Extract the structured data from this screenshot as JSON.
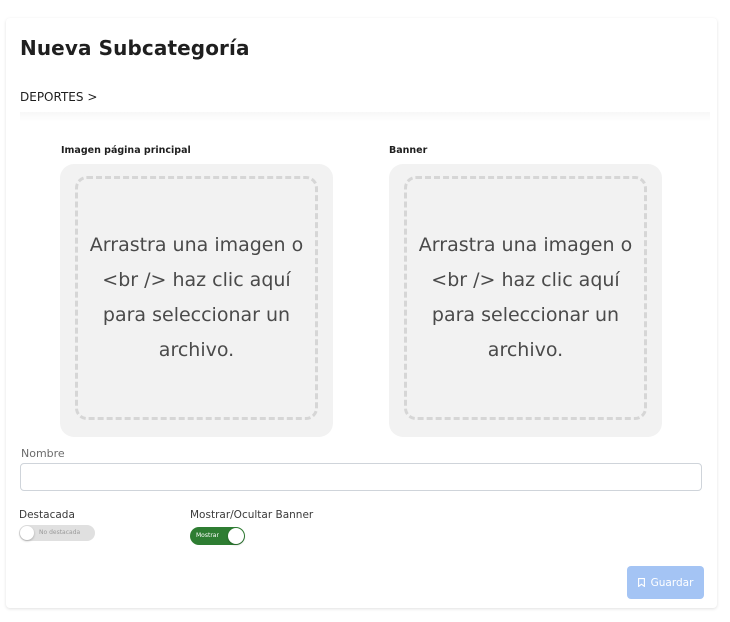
{
  "page": {
    "title": "Nueva Subcategoría",
    "breadcrumb": "DEPORTES >"
  },
  "uploads": {
    "main_image": {
      "label": "Imagen página principal",
      "placeholder": "Arrastra una imagen o <br /> haz clic aquí para seleccionar un archivo."
    },
    "banner": {
      "label": "Banner",
      "placeholder": "Arrastra una imagen o <br /> haz clic aquí para seleccionar un archivo."
    }
  },
  "form": {
    "name_label": "Nombre",
    "name_value": "",
    "featured": {
      "label": "Destacada",
      "state_text": "No destacada",
      "checked": false
    },
    "banner_toggle": {
      "label": "Mostrar/Ocultar Banner",
      "state_text": "Mostrar",
      "checked": true
    }
  },
  "actions": {
    "save_label": "Guardar",
    "save_icon": "bookmark-icon"
  },
  "colors": {
    "toggle_on": "#2e7d32",
    "toggle_off": "#e0e0e0",
    "save_button": "#a4c4f4",
    "dropzone_bg": "#f2f2f2"
  }
}
